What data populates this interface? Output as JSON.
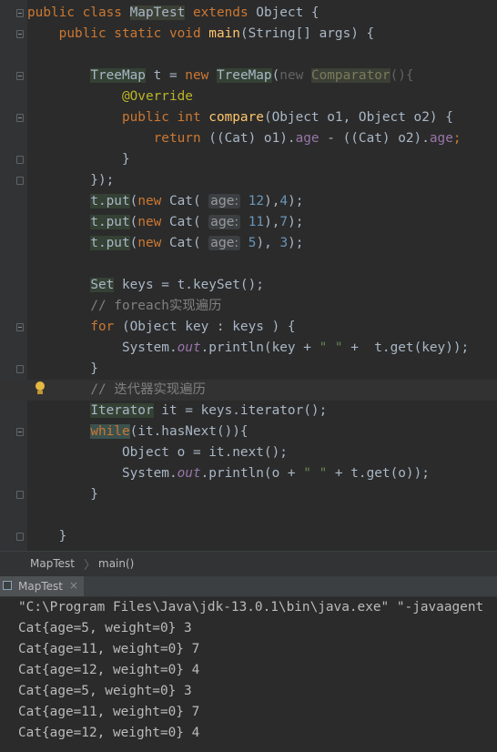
{
  "editor": {
    "lines": [
      [
        {
          "t": "public class ",
          "c": "kw"
        },
        {
          "t": "MapTest",
          "c": "hl-class"
        },
        {
          "t": " extends ",
          "c": "kw"
        },
        {
          "t": "Object {"
        }
      ],
      [
        {
          "t": "    public static void ",
          "c": "kw"
        },
        {
          "t": "main",
          "c": "fn"
        },
        {
          "t": "(String[] args) {"
        }
      ],
      [],
      [
        {
          "t": "        "
        },
        {
          "t": "TreeMap",
          "c": "hl-ref"
        },
        {
          "t": " t = "
        },
        {
          "t": "new ",
          "c": "kw"
        },
        {
          "t": "TreeMap",
          "c": "hl-ref"
        },
        {
          "t": "("
        },
        {
          "t": "new ",
          "c": "dim"
        },
        {
          "t": "Comparator",
          "c": "dimcls"
        },
        {
          "t": "(){",
          "c": "dim"
        }
      ],
      [
        {
          "t": "            "
        },
        {
          "t": "@Override",
          "c": "ann"
        }
      ],
      [
        {
          "t": "            "
        },
        {
          "t": "public int ",
          "c": "kw"
        },
        {
          "t": "compare",
          "c": "fn"
        },
        {
          "t": "(Object o1, Object o2) {"
        }
      ],
      [
        {
          "t": "                "
        },
        {
          "t": "return ",
          "c": "kw"
        },
        {
          "t": "((Cat) o1)."
        },
        {
          "t": "age",
          "c": "fld"
        },
        {
          "t": " - ((Cat) o2)."
        },
        {
          "t": "age",
          "c": "fld"
        },
        {
          "t": ";",
          "c": "kw"
        }
      ],
      [
        {
          "t": "            }"
        }
      ],
      [
        {
          "t": "        });"
        }
      ],
      [
        {
          "t": "        "
        },
        {
          "t": "t.put",
          "c": "hl-ref"
        },
        {
          "t": "("
        },
        {
          "t": "new ",
          "c": "kw"
        },
        {
          "t": "Cat( "
        },
        {
          "t": "age:",
          "c": "hint"
        },
        {
          "t": " "
        },
        {
          "t": "12",
          "c": "num"
        },
        {
          "t": "),"
        },
        {
          "t": "4",
          "c": "num"
        },
        {
          "t": ");"
        }
      ],
      [
        {
          "t": "        "
        },
        {
          "t": "t.put",
          "c": "hl-ref"
        },
        {
          "t": "("
        },
        {
          "t": "new ",
          "c": "kw"
        },
        {
          "t": "Cat( "
        },
        {
          "t": "age:",
          "c": "hint"
        },
        {
          "t": " "
        },
        {
          "t": "11",
          "c": "num"
        },
        {
          "t": "),"
        },
        {
          "t": "7",
          "c": "num"
        },
        {
          "t": ");"
        }
      ],
      [
        {
          "t": "        "
        },
        {
          "t": "t.put",
          "c": "hl-ref"
        },
        {
          "t": "("
        },
        {
          "t": "new ",
          "c": "kw"
        },
        {
          "t": "Cat( "
        },
        {
          "t": "age:",
          "c": "hint"
        },
        {
          "t": " "
        },
        {
          "t": "5",
          "c": "num"
        },
        {
          "t": "), "
        },
        {
          "t": "3",
          "c": "num"
        },
        {
          "t": ");"
        }
      ],
      [],
      [
        {
          "t": "        "
        },
        {
          "t": "Set",
          "c": "hl-ref"
        },
        {
          "t": " keys = t.keySet();"
        }
      ],
      [
        {
          "t": "        "
        },
        {
          "t": "// foreach",
          "c": "cmt"
        },
        {
          "t": "实现遍历",
          "c": "cmt-cjk"
        }
      ],
      [
        {
          "t": "        "
        },
        {
          "t": "for ",
          "c": "kw"
        },
        {
          "t": "(Object key : keys ) {"
        }
      ],
      [
        {
          "t": "            System."
        },
        {
          "t": "out",
          "c": "fld it"
        },
        {
          "t": ".println(key + "
        },
        {
          "t": "\" \"",
          "c": "str"
        },
        {
          "t": " +  t.get(key));"
        }
      ],
      [
        {
          "t": "        }"
        }
      ],
      [
        {
          "t": "        "
        },
        {
          "t": "// ",
          "c": "cmt"
        },
        {
          "t": "迭代器实现遍历",
          "c": "cmt-cjk"
        }
      ],
      [
        {
          "t": "        "
        },
        {
          "t": "Iterator",
          "c": "hl-ref"
        },
        {
          "t": " it = keys.iterator();"
        }
      ],
      [
        {
          "t": "        "
        },
        {
          "t": "while",
          "c": "kw hl-match"
        },
        {
          "t": "(it.hasNext()){"
        }
      ],
      [
        {
          "t": "            Object o = it.next();"
        }
      ],
      [
        {
          "t": "            System."
        },
        {
          "t": "out",
          "c": "fld it"
        },
        {
          "t": ".println(o + "
        },
        {
          "t": "\" \"",
          "c": "str"
        },
        {
          "t": " + t.get(o));"
        }
      ],
      [
        {
          "t": "        }"
        }
      ],
      [],
      [
        {
          "t": "    }"
        }
      ]
    ]
  },
  "breadcrumb": {
    "class_name": "MapTest",
    "method_name": "main()",
    "separator": "〉"
  },
  "run_panel": {
    "tab_label": "MapTest",
    "tab_close": "×",
    "output": [
      "\"C:\\Program Files\\Java\\jdk-13.0.1\\bin\\java.exe\" \"-javaagent",
      "Cat{age=5, weight=0} 3",
      "Cat{age=11, weight=0} 7",
      "Cat{age=12, weight=0} 4",
      "Cat{age=5, weight=0} 3",
      "Cat{age=11, weight=0} 7",
      "Cat{age=12, weight=0} 4"
    ]
  },
  "icons": {
    "gutter_bulb": "lightbulb-icon",
    "fold_marker": "fold-icon",
    "run_tab": "class-icon"
  },
  "colors": {
    "keyword": "#cc7832",
    "method": "#ffc66d",
    "number": "#6897bb",
    "string": "#6a8759",
    "field": "#9876aa",
    "annotation": "#bbb529",
    "comment": "#808080",
    "text": "#a9b7c6"
  }
}
